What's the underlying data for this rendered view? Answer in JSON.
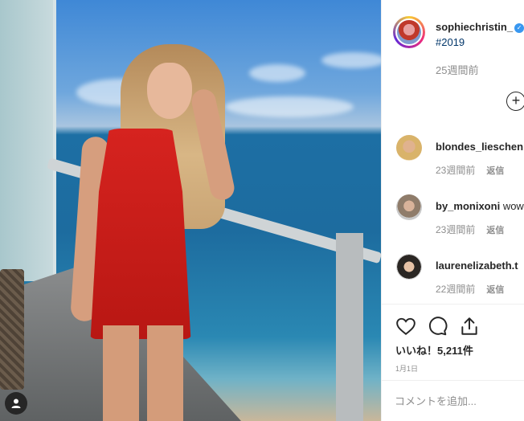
{
  "post": {
    "username": "sophiechristin_",
    "verified_mark": "✓",
    "caption_emoji": "",
    "hashtag": "#2019",
    "time_ago": "25週間前",
    "add_symbol": "+"
  },
  "comments": [
    {
      "username": "blondes_lieschen",
      "text": "",
      "time": "23週間前",
      "reply": "返信"
    },
    {
      "username": "by_monixoni",
      "text": "wow",
      "time": "23週間前",
      "reply": "返信"
    },
    {
      "username": "laurenelizabeth.t",
      "text": "",
      "time": "22週間前",
      "reply": "返信"
    }
  ],
  "actions": {
    "icons": [
      "heart-icon",
      "comment-icon",
      "share-icon"
    ],
    "likes_text": "いいね！5,211件",
    "date": "1月1日"
  },
  "comment_box": {
    "placeholder": "コメントを追加..."
  },
  "colors": {
    "link": "#003569",
    "muted": "#8e8e8e",
    "text": "#262626",
    "verified": "#3897f0"
  }
}
